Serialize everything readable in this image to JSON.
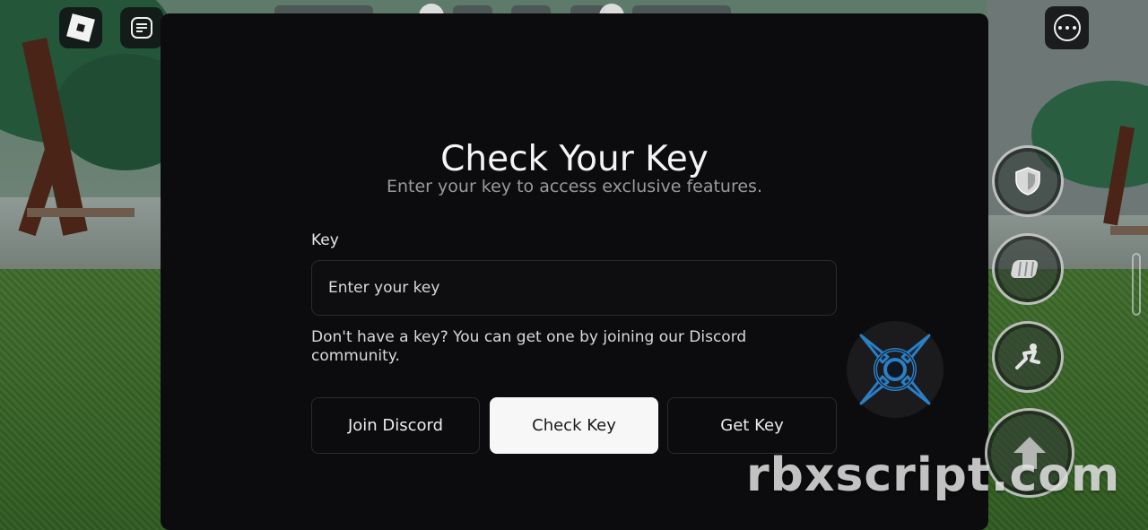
{
  "modal": {
    "title": "Check Your Key",
    "subtitle": "Enter your key to access exclusive features.",
    "key_label": "Key",
    "key_input": {
      "placeholder": "Enter your key",
      "value": ""
    },
    "helper_text": "Don't have a key? You can get one by joining our Discord community.",
    "buttons": {
      "join_discord": "Join Discord",
      "check_key": "Check Key",
      "get_key": "Get Key"
    }
  },
  "hud": {
    "top_left": [
      {
        "icon": "roblox-logo-icon"
      },
      {
        "icon": "chat-icon"
      }
    ],
    "top_right": {
      "icon": "more-menu-icon"
    },
    "actions": [
      {
        "icon": "shield-icon"
      },
      {
        "icon": "fist-icon"
      },
      {
        "icon": "sprint-icon"
      },
      {
        "icon": "jump-arrow-icon"
      }
    ]
  },
  "overlay_logo": {
    "icon": "shuriken-icon",
    "color": "#1f6fb0"
  },
  "watermark": "rbxscript.com",
  "colors": {
    "modal_bg": "#0c0c0e",
    "primary_button_bg": "#f7f7f7",
    "outline_border": "#2a2a2e"
  }
}
